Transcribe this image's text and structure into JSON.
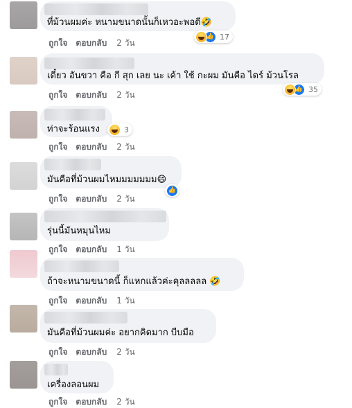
{
  "actions": {
    "like": "ถูกใจ",
    "reply": "ตอบกลับ"
  },
  "colors": {
    "bubble": "#f0f2f5",
    "secondary_text": "#65676b",
    "like_blue": "#1877f2",
    "haha_yellow": "#f7b125"
  },
  "comments": [
    {
      "text": "ที่ม้วนผมค่ะ หนามขนาดนั้นก็เหวอะพอดี",
      "emoji": "🤣",
      "reactions": [
        "haha-icon",
        "like-icon"
      ],
      "reaction_count": "17",
      "time": "2 วัน"
    },
    {
      "text": "เดี๋ยว อันขวา คือ กี สุก เลย นะ เค้า ใช้ กะผม มันคือ ไดร์ ม้วนโรล",
      "emoji": "",
      "reactions": [
        "haha-icon",
        "like-icon"
      ],
      "reaction_count": "35",
      "time": "2 วัน"
    },
    {
      "text": "ท่าจะร้อนแรง",
      "emoji": "",
      "reactions": [
        "haha-icon"
      ],
      "reaction_count": "3",
      "time": "2 วัน"
    },
    {
      "text": "มันคือที่ม้วนผมไหมมมมมมม",
      "emoji": "😄",
      "reactions": [
        "like-icon"
      ],
      "reaction_count": "",
      "time": "2 วัน"
    },
    {
      "text": "รุ่นนี้มันหมุนไหม",
      "emoji": "",
      "reactions": [],
      "reaction_count": "",
      "time": "1 วัน"
    },
    {
      "text": "ถ้าจะหนามขนาดนี้ ก็แหกแล้วค่ะคุลลลลล",
      "emoji": "🤣",
      "reactions": [],
      "reaction_count": "",
      "time": "1 วัน"
    },
    {
      "text": "มันคือที่ม้วนผมค่ะ อยากคิดมาก บีบมือ",
      "emoji": "",
      "reactions": [],
      "reaction_count": "",
      "time": "2 วัน"
    },
    {
      "text": "เครื่องลอนผม",
      "emoji": "",
      "reactions": [],
      "reaction_count": "",
      "time": "2 วัน"
    }
  ]
}
